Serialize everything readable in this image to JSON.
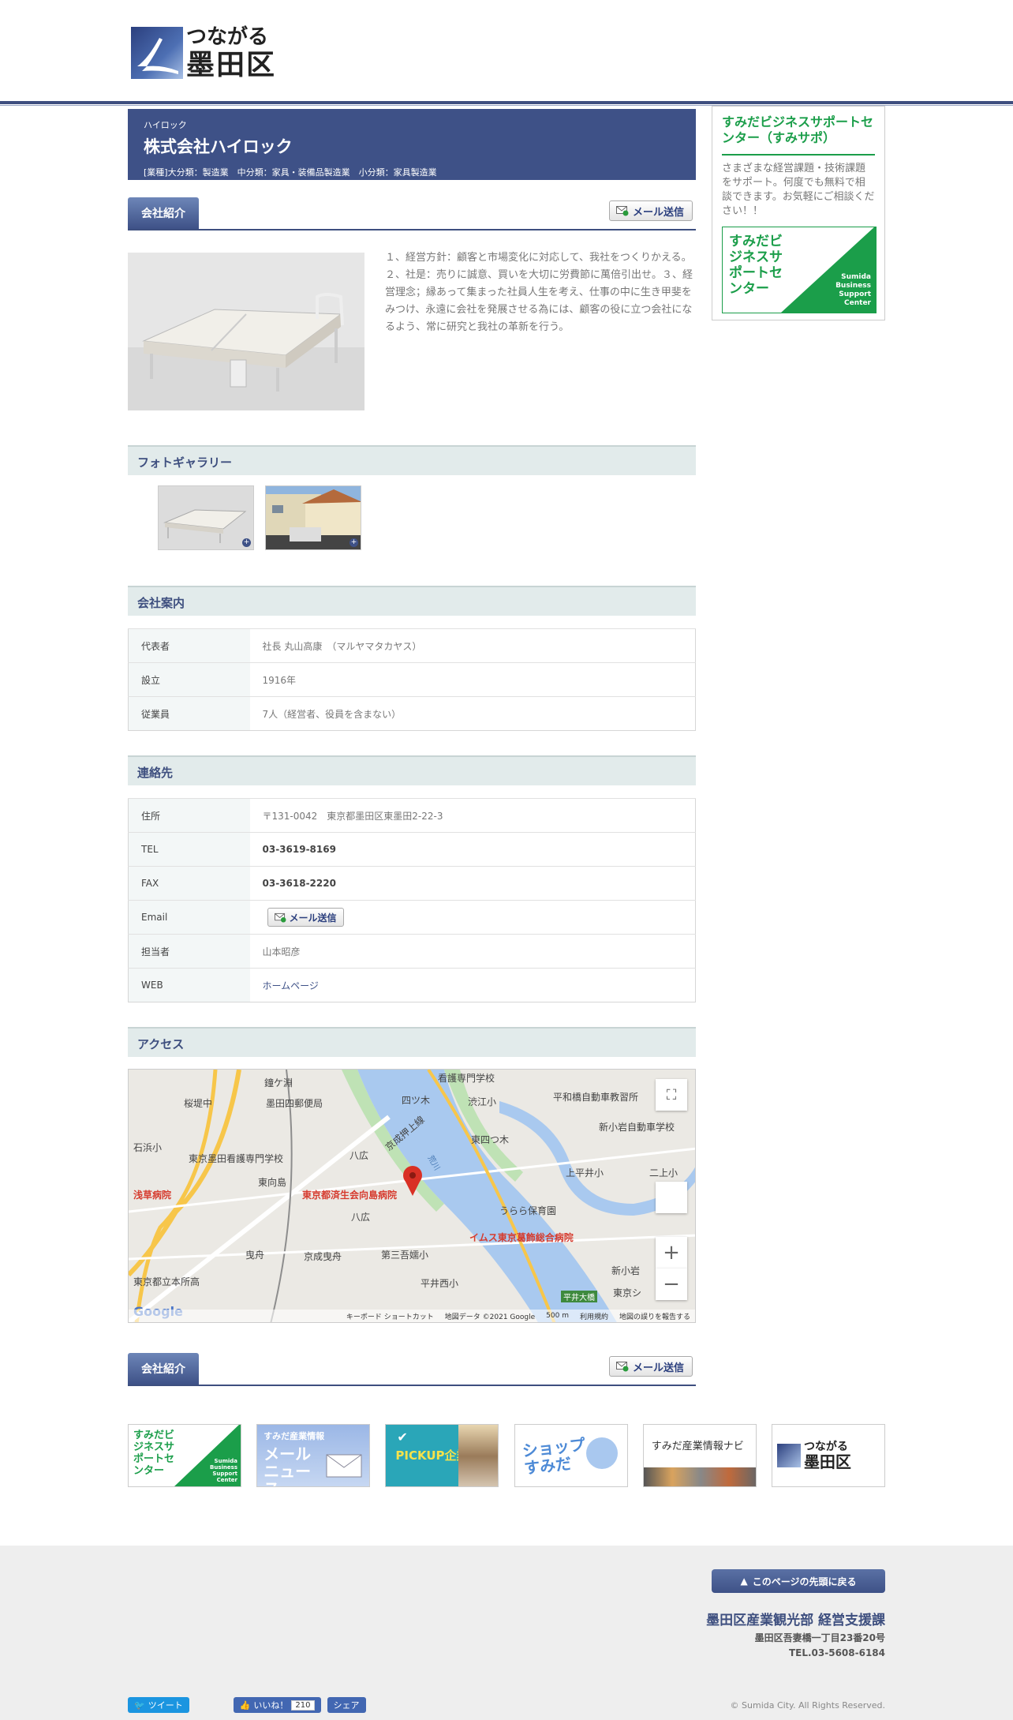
{
  "header": {
    "logo_line1": "つながる",
    "logo_line2": "墨田区"
  },
  "company": {
    "kana": "ハイロック",
    "name": "株式会社ハイロック",
    "category": "[業種]大分類：製造業　中分類：家具・装備品製造業　小分類：家具製造業"
  },
  "intro": {
    "tab_label": "会社紹介",
    "mail_button": "メール送信",
    "text": "１、経営方針：顧客と市場変化に対応して、我社をつくりかえる。２、社是：売りに誠意、買いを大切に労費節に萬倍引出せ。３、経営理念；縁あって集まった社員人生を考え、仕事の中に生き甲斐をみつけ、永遠に会社を発展させる為には、顧客の役に立つ会社になるよう、常に研究と我社の革新を行う。"
  },
  "gallery": {
    "title": "フォトギャラリー"
  },
  "company_info": {
    "title": "会社案内",
    "rows": [
      {
        "key": "代表者",
        "value": "社長 丸山高康　（マルヤマタカヤス）"
      },
      {
        "key": "設立",
        "value": "1916年"
      },
      {
        "key": "従業員",
        "value": "7人（経営者、役員を含まない）"
      }
    ]
  },
  "contact": {
    "title": "連絡先",
    "address_key": "住所",
    "address": "〒131-0042　東京都墨田区東墨田2-22-3",
    "tel_key": "TEL",
    "tel": "03-3619-8169",
    "fax_key": "FAX",
    "fax": "03-3618-2220",
    "email_key": "Email",
    "email_button": "メール送信",
    "person_key": "担当者",
    "person": "山本昭彦",
    "web_key": "WEB",
    "web_link": "ホームページ"
  },
  "access": {
    "title": "アクセス",
    "map_labels": {
      "l1": "鐘ケ淵",
      "l2": "看護専門学校",
      "l3": "桜堤中",
      "l4": "墨田四郵便局",
      "l5": "四ツ木",
      "l6": "渋江小",
      "l7": "平和橋自動車教習所",
      "l8": "石浜小",
      "l9": "新小岩自動車学校",
      "l10": "東京墨田看護専門学校",
      "l11": "八広",
      "l12": "東四つ木",
      "l13": "東向島",
      "l14": "上平井小",
      "l15": "二上小",
      "l16": "浅草病院",
      "l17": "東京都済生会向島病院",
      "l18": "うらら保育園",
      "l19": "八広",
      "l20": "イムス東京葛飾総合病院",
      "l21": "曳舟",
      "l22": "京成曳舟",
      "l23": "第三吾嬬小",
      "l24": "新小岩",
      "l25": "東京都立本所高",
      "l26": "平井西小",
      "l27": "平井大橋",
      "l28": "東京シ",
      "l29": "京成押上線",
      "l30": "荒川"
    },
    "footer": {
      "shortcut": "キーボード ショートカット",
      "mapdata": "地図データ ©2021 Google",
      "scale": "500 m",
      "terms": "利用規約",
      "report": "地図の誤りを報告する"
    },
    "google": "Google"
  },
  "bottom_intro": {
    "tab_label": "会社紹介",
    "mail_button": "メール送信"
  },
  "sidebar": {
    "title": "すみだビジネスサポートセンター（すみサポ）",
    "description": "さまざまな経営課題・技術課題をサポート。何度でも無料で相談できます。お気軽にご相談ください！！",
    "banner_ja": "すみだビジネスサポートセンター",
    "banner_en": "Sumida Business Support Center"
  },
  "banners": {
    "b1_ja": "すみだビジネスサポートセンター",
    "b1_en": "Sumida Business Support Center",
    "b2_small": "すみだ産業情報",
    "b2_big": "メールニュース",
    "b3": "PICKUP企業",
    "b4": "ショップすみだ",
    "b5": "すみだ産業情報ナビ",
    "b6_line1": "つながる",
    "b6_line2": "墨田区"
  },
  "footer": {
    "to_top": "このページの先頭に戻る",
    "department": "墨田区産業観光部 経営支援課",
    "address": "墨田区吾妻橋一丁目23番20号",
    "tel": "TEL.03-5608-6184",
    "tweet": "ツイート",
    "like": "いいね！",
    "like_count": "210",
    "share": "シェア",
    "copyright": "© Sumida City. All Rights Reserved."
  },
  "colors": {
    "brand_navy": "#3e5187",
    "green": "#1b9e4a",
    "section_bg": "#e2ebeb"
  }
}
